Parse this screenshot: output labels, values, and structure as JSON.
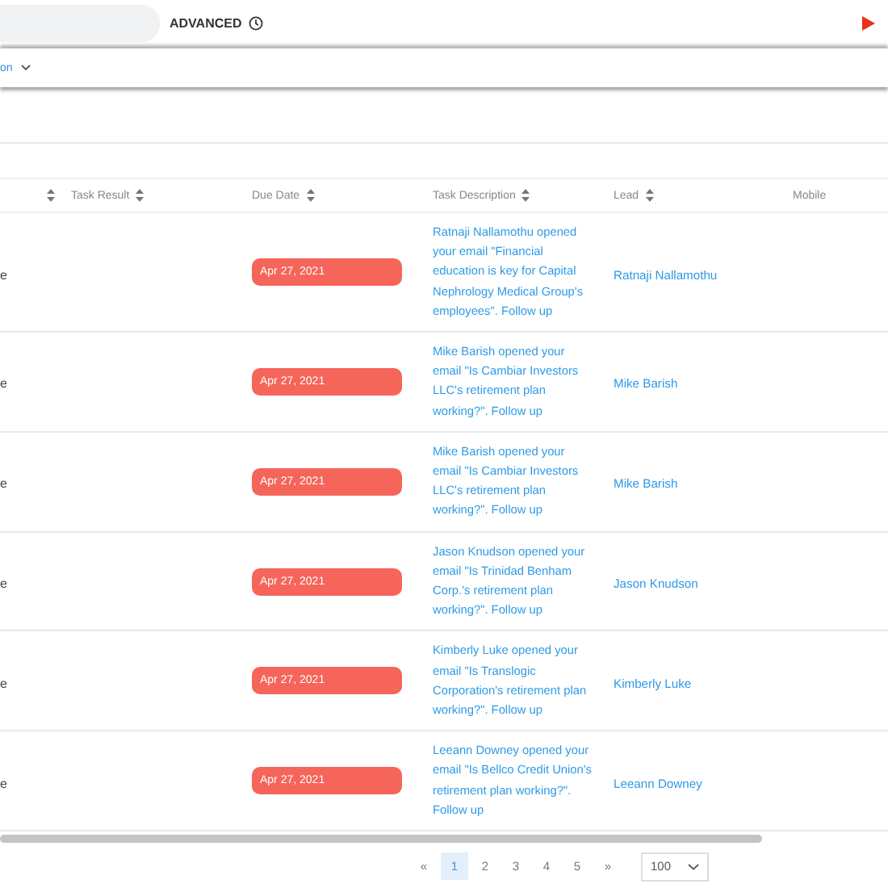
{
  "toolbar": {
    "advanced_label": "ADVANCED"
  },
  "filter_bar": {
    "dropdown_label": "on"
  },
  "table": {
    "columns": [
      {
        "sortable": true
      },
      {
        "label": "Task Result",
        "sortable": true
      },
      {
        "label": "Due Date",
        "sortable": true
      },
      {
        "label": "Task Description",
        "sortable": true
      },
      {
        "label": "Lead",
        "sortable": true
      },
      {
        "label": "Mobile",
        "sortable": false
      }
    ],
    "rows": [
      {
        "column_1": "e",
        "due_date": "Apr 27, 2021",
        "overdue": true,
        "description": "Ratnaji Nallamothu opened your email \"Financial education is key for Capital Nephrology Medical Group's employees\". Follow up",
        "lead": "Ratnaji Nallamothu"
      },
      {
        "column_1": "e",
        "due_date": "Apr 27, 2021",
        "overdue": true,
        "description": "Mike Barish opened your email \"Is Cambiar Investors LLC's retirement plan working?\". Follow up",
        "lead": "Mike Barish"
      },
      {
        "column_1": "e",
        "due_date": "Apr 27, 2021",
        "overdue": true,
        "description": "Mike Barish opened your email \"Is Cambiar Investors LLC's retirement plan working?\". Follow up",
        "lead": "Mike Barish"
      },
      {
        "column_1": "e",
        "due_date": "Apr 27, 2021",
        "overdue": true,
        "description": "Jason Knudson opened your email \"Is Trinidad Benham Corp.'s retirement plan working?\". Follow up",
        "lead": "Jason Knudson"
      },
      {
        "column_1": "e",
        "due_date": "Apr 27, 2021",
        "overdue": true,
        "description": "Kimberly Luke opened your email \"Is Translogic Corporation's retirement plan working?\". Follow up",
        "lead": "Kimberly Luke"
      },
      {
        "column_1": "e",
        "due_date": "Apr 27, 2021",
        "overdue": true,
        "description": "Leeann Downey opened your email \"Is Bellco Credit Union's retirement plan working?\". Follow up",
        "lead": "Leeann Downey"
      }
    ]
  },
  "pagination": {
    "first": "«",
    "pages": [
      {
        "label": "1",
        "selected": true
      },
      {
        "label": "2",
        "selected": false
      },
      {
        "label": "3",
        "selected": false
      },
      {
        "label": "4",
        "selected": false
      },
      {
        "label": "5",
        "selected": false
      }
    ],
    "last": "»",
    "page_size": "100"
  }
}
